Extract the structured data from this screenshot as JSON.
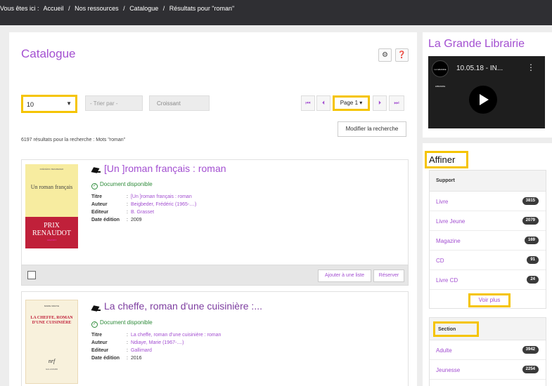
{
  "breadcrumb": {
    "prefix": "Vous êtes ici :",
    "items": [
      "Accueil",
      "/",
      "Nos ressources",
      "/",
      "Catalogue",
      "/",
      "Résultats pour \"roman\""
    ]
  },
  "main": {
    "title": "Catalogue",
    "icons": {
      "settings": "gear-icon",
      "help": "question-icon"
    },
    "per_page": "10",
    "sort_placeholder": "- Trier par -",
    "order": "Croissant",
    "pagination": {
      "first": "⏮",
      "prev": "⏴",
      "current": "Page 1",
      "next": "⏵",
      "last": "⏭"
    },
    "modify_label": "Modifier la recherche",
    "results_text": "6197 résultats pour la recherche : Mots \"roman\"",
    "results": [
      {
        "title": "[Un ]roman français : roman",
        "availability": "Document disponible",
        "cover": {
          "publisher_top": "FRÉDÉRIC BEIGBEDER",
          "title": "Un roman français",
          "band_1": "PRIX",
          "band_2": "RENAUDOT",
          "band_3": "GRASSET"
        },
        "fields": [
          {
            "key": "Titre",
            "value": "[Un ]roman français : roman",
            "link": true
          },
          {
            "key": "Auteur",
            "value": "Beigbeder, Frédéric (1965-....)",
            "link": true
          },
          {
            "key": "Editeur",
            "value": "B. Grasset",
            "link": true
          },
          {
            "key": "Date édition",
            "value": "2009",
            "link": false
          }
        ],
        "add_to_list": "Ajouter à une liste",
        "reserve": "Réserver"
      },
      {
        "title": "La cheffe, roman d'une cuisinière :...",
        "availability": "Document disponible",
        "cover": {
          "publisher_top": "MARIE NDIAYE",
          "title": "LA CHEFFE, ROMAN D'UNE CUISINIÈRE",
          "logo": "nrf",
          "publisher_bottom": "GALLIMARD"
        },
        "fields": [
          {
            "key": "Titre",
            "value": "La cheffe, roman d'une cuisinière : roman",
            "link": true
          },
          {
            "key": "Auteur",
            "value": "Ndiaye, Marie (1967-....)",
            "link": true
          },
          {
            "key": "Editeur",
            "value": "Gallimard",
            "link": true
          },
          {
            "key": "Date édition",
            "value": "2016",
            "link": false
          }
        ]
      }
    ]
  },
  "sidebar": {
    "title": "La Grande Librairie",
    "video": {
      "title": "10.05.18 - IN...",
      "channel_logo": "LA GRANDE LIBRAIRIE",
      "menu": "⋮"
    },
    "refine_title": "Affiner",
    "support": {
      "heading": "Support",
      "items": [
        {
          "label": "Livre",
          "count": "3815"
        },
        {
          "label": "Livre Jeune",
          "count": "2079"
        },
        {
          "label": "Magazine",
          "count": "169"
        },
        {
          "label": "CD",
          "count": "91"
        },
        {
          "label": "Livre CD",
          "count": "24"
        }
      ],
      "more": "Voir plus"
    },
    "section": {
      "heading": "Section",
      "items": [
        {
          "label": "Adulte",
          "count": "3942"
        },
        {
          "label": "Jeunesse",
          "count": "2254"
        }
      ]
    }
  },
  "colors": {
    "accent": "#a34fd1",
    "highlight": "#f5c400",
    "available": "#2e8b3a",
    "topbar": "#2f2f33"
  }
}
